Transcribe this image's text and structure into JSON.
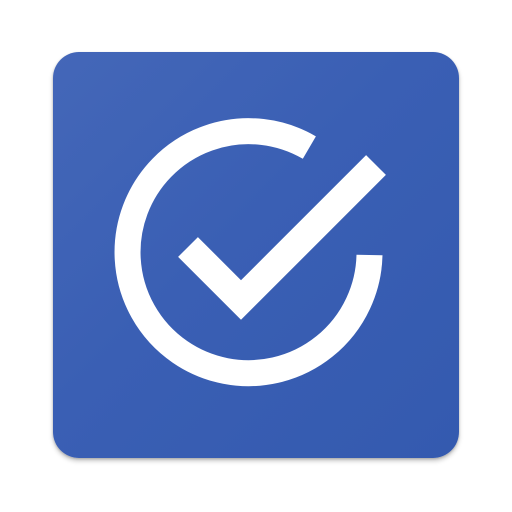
{
  "app_icon": {
    "name": "check-circle-app-icon",
    "background_color": "#3b60b4",
    "glyph_color": "#ffffff",
    "glyph": "circle-check-icon"
  }
}
